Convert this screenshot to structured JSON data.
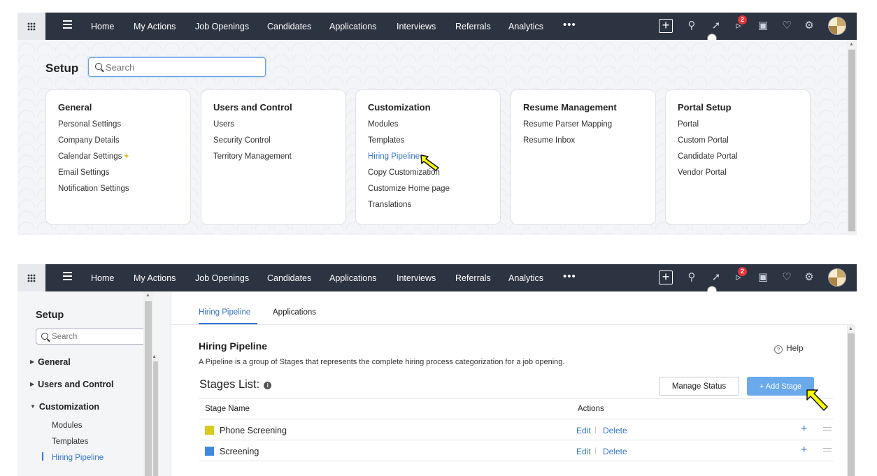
{
  "nav": {
    "items": [
      "Home",
      "My Actions",
      "Job Openings",
      "Candidates",
      "Applications",
      "Interviews",
      "Referrals",
      "Analytics"
    ],
    "more": "•••",
    "badge_count": "2",
    "icons": [
      "apps-grid-icon",
      "hamburger-menu-icon",
      "plus-icon",
      "search-icon",
      "rocket-icon",
      "announcement-icon",
      "calendar-icon",
      "bell-icon",
      "gear-icon",
      "avatar"
    ]
  },
  "setup_page": {
    "title": "Setup",
    "search_value": "",
    "search_placeholder": "Search",
    "cards": [
      {
        "title": "General",
        "links": [
          "Personal Settings",
          "Company Details",
          "Calendar Settings",
          "Email Settings",
          "Notification Settings"
        ]
      },
      {
        "title": "Users and Control",
        "links": [
          "Users",
          "Security Control",
          "Territory Management"
        ]
      },
      {
        "title": "Customization",
        "links": [
          "Modules",
          "Templates",
          "Hiring Pipeline",
          "Copy Customization",
          "Customize Home page",
          "Translations"
        ],
        "active_link": "Hiring Pipeline"
      },
      {
        "title": "Resume Management",
        "links": [
          "Resume Parser Mapping",
          "Resume Inbox"
        ]
      },
      {
        "title": "Portal Setup",
        "links": [
          "Portal",
          "Custom Portal",
          "Candidate Portal",
          "Vendor Portal"
        ]
      }
    ]
  },
  "pipeline_page": {
    "sidebar": {
      "title": "Setup",
      "search_placeholder": "Search",
      "sections": [
        "General",
        "Users and Control",
        "Customization"
      ],
      "sub_items": [
        "Modules",
        "Templates",
        "Hiring Pipeline"
      ]
    },
    "tabs": [
      "Hiring Pipeline",
      "Applications"
    ],
    "title": "Hiring Pipeline",
    "description": "A Pipeline is a group of Stages that represents the complete hiring process categorization for a job opening.",
    "help_label": "Help",
    "stages_title": "Stages List:",
    "manage_status_label": "Manage Status",
    "add_stage_label": "+ Add Stage",
    "columns": [
      "Stage Name",
      "Actions"
    ],
    "rows": [
      {
        "name": "Phone Screening",
        "color": "#d6cb1e",
        "edit": "Edit",
        "delete": "Delete"
      },
      {
        "name": "Screening",
        "color": "#3f8ae0",
        "edit": "Edit",
        "delete": "Delete"
      }
    ]
  },
  "colors": {
    "navbar": "#2c3341",
    "accent": "#3474d2",
    "add_button": "#6aa9ec",
    "badge": "#e8333b",
    "cursor_arrow": "#f6ff00"
  }
}
